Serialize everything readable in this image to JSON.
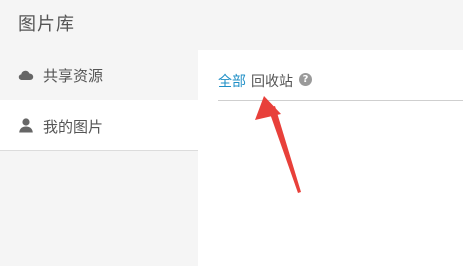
{
  "app": {
    "title": "图片库"
  },
  "sidebar": {
    "items": [
      {
        "label": "共享资源",
        "icon": "cloud-icon"
      },
      {
        "label": "我的图片",
        "icon": "user-icon",
        "selected": true
      }
    ]
  },
  "main": {
    "tabs": [
      {
        "label": "全部",
        "active": true
      },
      {
        "label": "回收站",
        "active": false
      }
    ],
    "help_icon": "question-icon"
  },
  "colors": {
    "accent": "#1f8fc6",
    "annotation_arrow": "#e8403a"
  }
}
